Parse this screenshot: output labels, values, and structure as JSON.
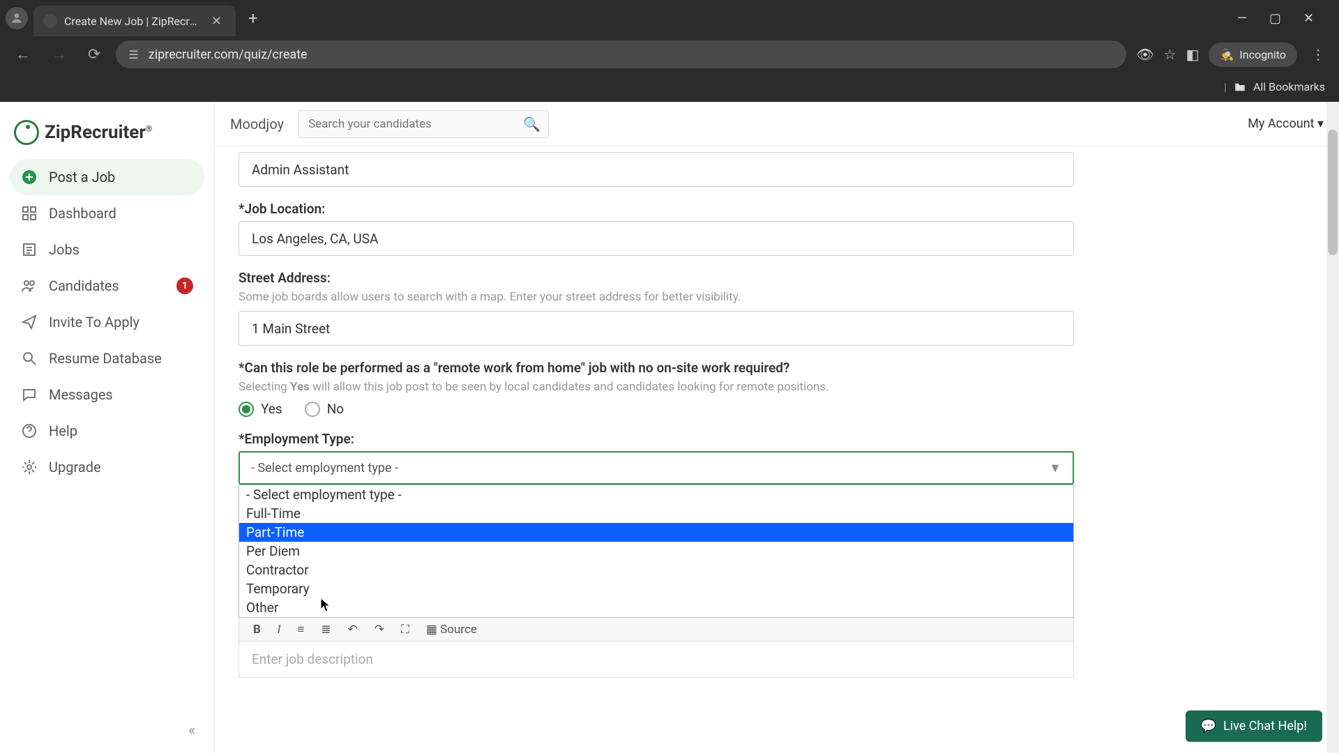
{
  "browser": {
    "tab_title": "Create New Job | ZipRecruiter",
    "url": "ziprecruiter.com/quiz/create",
    "incognito_label": "Incognito",
    "all_bookmarks": "All Bookmarks"
  },
  "logo": {
    "text": "ZipRecruiter"
  },
  "sidebar": {
    "items": [
      {
        "label": "Post a Job"
      },
      {
        "label": "Dashboard"
      },
      {
        "label": "Jobs"
      },
      {
        "label": "Candidates",
        "badge": "1"
      },
      {
        "label": "Invite To Apply"
      },
      {
        "label": "Resume Database"
      },
      {
        "label": "Messages"
      },
      {
        "label": "Help"
      },
      {
        "label": "Upgrade"
      }
    ]
  },
  "topbar": {
    "org": "Moodjoy",
    "search_placeholder": "Search your candidates",
    "account": "My Account ▾"
  },
  "form": {
    "job_title_value": "Admin Assistant",
    "location_label": "*Job Location:",
    "location_value": "Los Angeles, CA, USA",
    "street_label": "Street Address:",
    "street_hint": "Some job boards allow users to search with a map. Enter your street address for better visibility.",
    "street_value": "1 Main Street",
    "remote_label": "*Can this role be performed as a \"remote work from home\" job with no on-site work required?",
    "remote_hint_pre": "Selecting ",
    "remote_hint_bold": "Yes",
    "remote_hint_post": " will allow this job post to be seen by local candidates and candidates looking for remote positions.",
    "radio_yes": "Yes",
    "radio_no": "No",
    "emp_type_label": "*Employment Type:",
    "emp_type_selected": "- Select employment type -",
    "emp_type_options": [
      "- Select employment type -",
      "Full-Time",
      "Part-Time",
      "Per Diem",
      "Contractor",
      "Temporary",
      "Other"
    ],
    "emp_type_highlight_index": 2,
    "editor_source": "Source",
    "editor_placeholder": "Enter job description"
  },
  "chat": {
    "label": "Live Chat Help!"
  }
}
